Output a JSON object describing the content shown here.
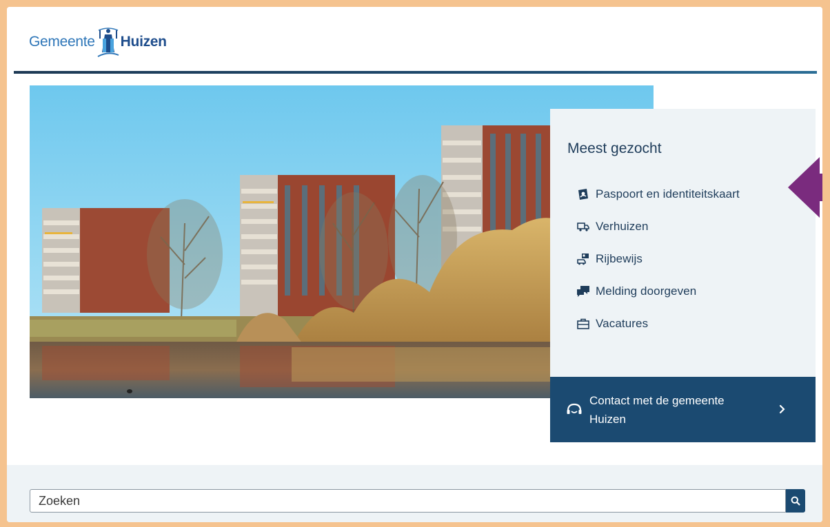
{
  "header": {
    "logo_part1": "Gemeente",
    "logo_part2": "Huizen"
  },
  "hero": {
    "image_icon": "apartment-buildings-pond-photo"
  },
  "most_searched": {
    "title": "Meest gezocht",
    "items": [
      {
        "label": "Paspoort en identiteitskaart",
        "icon": "passport-icon"
      },
      {
        "label": "Verhuizen",
        "icon": "moving-truck-icon"
      },
      {
        "label": "Rijbewijs",
        "icon": "drivers-license-icon"
      },
      {
        "label": "Melding doorgeven",
        "icon": "speech-bubbles-icon"
      },
      {
        "label": "Vacatures",
        "icon": "briefcase-icon"
      }
    ]
  },
  "contact": {
    "label": "Contact met de gemeente Huizen",
    "icon": "headset-icon"
  },
  "search": {
    "placeholder": "Zoeken"
  },
  "colors": {
    "frame": "#f5c38f",
    "primary_dark": "#1b4a71",
    "panel_bg": "#eef3f6",
    "arrow": "#7a2b7e"
  }
}
